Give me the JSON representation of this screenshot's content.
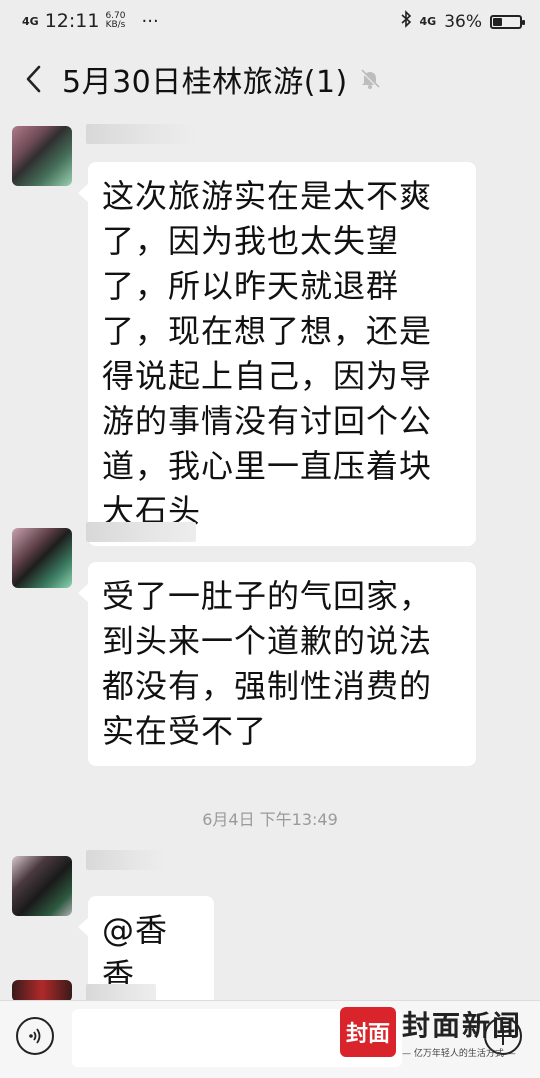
{
  "status_bar": {
    "network": "4G",
    "time": "12:11",
    "speed_value": "6.70",
    "speed_unit": "KB/s",
    "more": "···",
    "network_right": "4G",
    "battery": "36%",
    "battery_level": 0.36
  },
  "header": {
    "title": "5月30日桂林旅游(1)"
  },
  "messages": [
    {
      "text": "这次旅游实在是太不爽了，因为我也太失望了，所以昨天就退群了，现在想了想，还是得说起上自己，因为导游的事情没有讨回个公道，我心里一直压着块大石头"
    },
    {
      "text": "受了一肚子的气回家，到头来一个道歉的说法都没有，强制性消费的实在受不了"
    },
    {
      "text": "@香香"
    }
  ],
  "timestamp": "6月4日 下午13:49",
  "watermark": {
    "logo_text": "封面",
    "name": "封面新闻",
    "slogan": "— 亿万年轻人的生活方式 —"
  },
  "colors": {
    "background": "#ededed",
    "bubble": "#ffffff",
    "brand_red": "#d9242b"
  }
}
